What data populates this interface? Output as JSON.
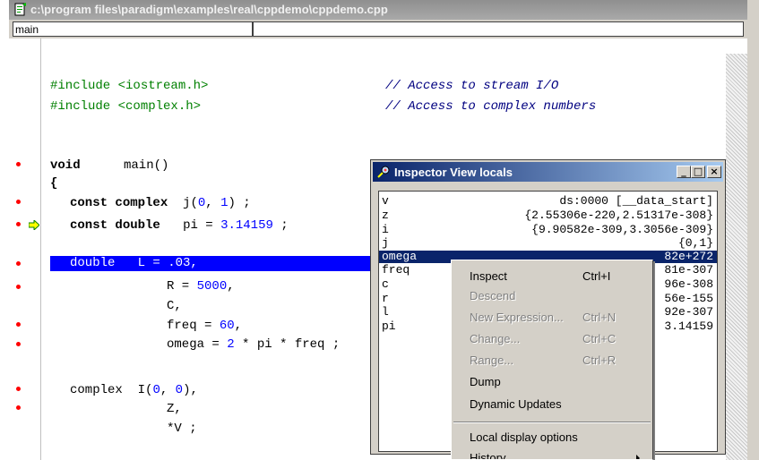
{
  "editor": {
    "title": "c:\\program files\\paradigm\\examples\\real\\cppdemo\\cppdemo.cpp",
    "function_box": "main"
  },
  "code": {
    "include1": "#include <iostream.h>",
    "include1_comment": "// Access to stream I/O",
    "include2": "#include <complex.h>",
    "include2_comment": "// Access to complex numbers",
    "line_void": "void",
    "line_main": "main()",
    "line_brace": "{",
    "const1_kw": "const",
    "const1_type": "complex",
    "const1_rest": "j(",
    "const1_n1": "0",
    "const1_mid": ", ",
    "const1_n2": "1",
    "const1_end": ") ;",
    "const2_kw": "const",
    "const2_type": "double",
    "const2_rest": "pi = ",
    "const2_num": "3.14159",
    "const2_end": " ;",
    "exec_line": "double   L = .03,",
    "r_line": "R = ",
    "r_num": "5000",
    "r_end": ",",
    "c_line": "C,",
    "freq_line": "freq = ",
    "freq_num": "60",
    "freq_end": ",",
    "omega_line": "omega = ",
    "omega_num": "2",
    "omega_end": " * pi * freq ;",
    "complex_kw": "complex",
    "complex_rest": "I(",
    "complex_n1": "0",
    "complex_mid": ", ",
    "complex_n2": "0",
    "complex_end": "),",
    "z_line": "Z,",
    "v_line": "*V ;"
  },
  "inspector": {
    "title": "Inspector View locals",
    "rows": [
      {
        "name": "v",
        "value": "ds:0000 [__data_start]"
      },
      {
        "name": "z",
        "value": "{2.55306e-220,2.51317e-308}"
      },
      {
        "name": "i",
        "value": "{9.90582e-309,3.3056e-309}"
      },
      {
        "name": "j",
        "value": "{0,1}"
      },
      {
        "name": "omega",
        "value": "82e+272"
      },
      {
        "name": "freq",
        "value": "81e-307"
      },
      {
        "name": "c",
        "value": "96e-308"
      },
      {
        "name": "r",
        "value": "56e-155"
      },
      {
        "name": "l",
        "value": "92e-307"
      },
      {
        "name": "pi",
        "value": "3.14159"
      }
    ],
    "min_btn": "_",
    "max_btn": "□",
    "close_btn": "×"
  },
  "context_menu": {
    "items": [
      {
        "label": "Inspect",
        "shortcut": "Ctrl+I",
        "enabled": true
      },
      {
        "label": "Descend",
        "shortcut": "",
        "enabled": false
      },
      {
        "label": "New Expression...",
        "shortcut": "Ctrl+N",
        "enabled": false
      },
      {
        "label": "Change...",
        "shortcut": "Ctrl+C",
        "enabled": false
      },
      {
        "label": "Range...",
        "shortcut": "Ctrl+R",
        "enabled": false
      },
      {
        "label": "Dump",
        "shortcut": "",
        "enabled": true
      },
      {
        "label": "Dynamic Updates",
        "shortcut": "",
        "enabled": true
      },
      {
        "label": "Local display options",
        "shortcut": "",
        "enabled": true
      },
      {
        "label": "History",
        "shortcut": "",
        "enabled": true
      }
    ]
  },
  "colors": {
    "selection": "#0000ff",
    "breakpoint": "#ff0000",
    "include": "#008000",
    "comment": "#000080",
    "number": "#0000ff"
  },
  "icons": {
    "editor": "source-file-icon",
    "inspector": "inspector-icon",
    "exec_pointer": "execution-arrow-icon"
  }
}
